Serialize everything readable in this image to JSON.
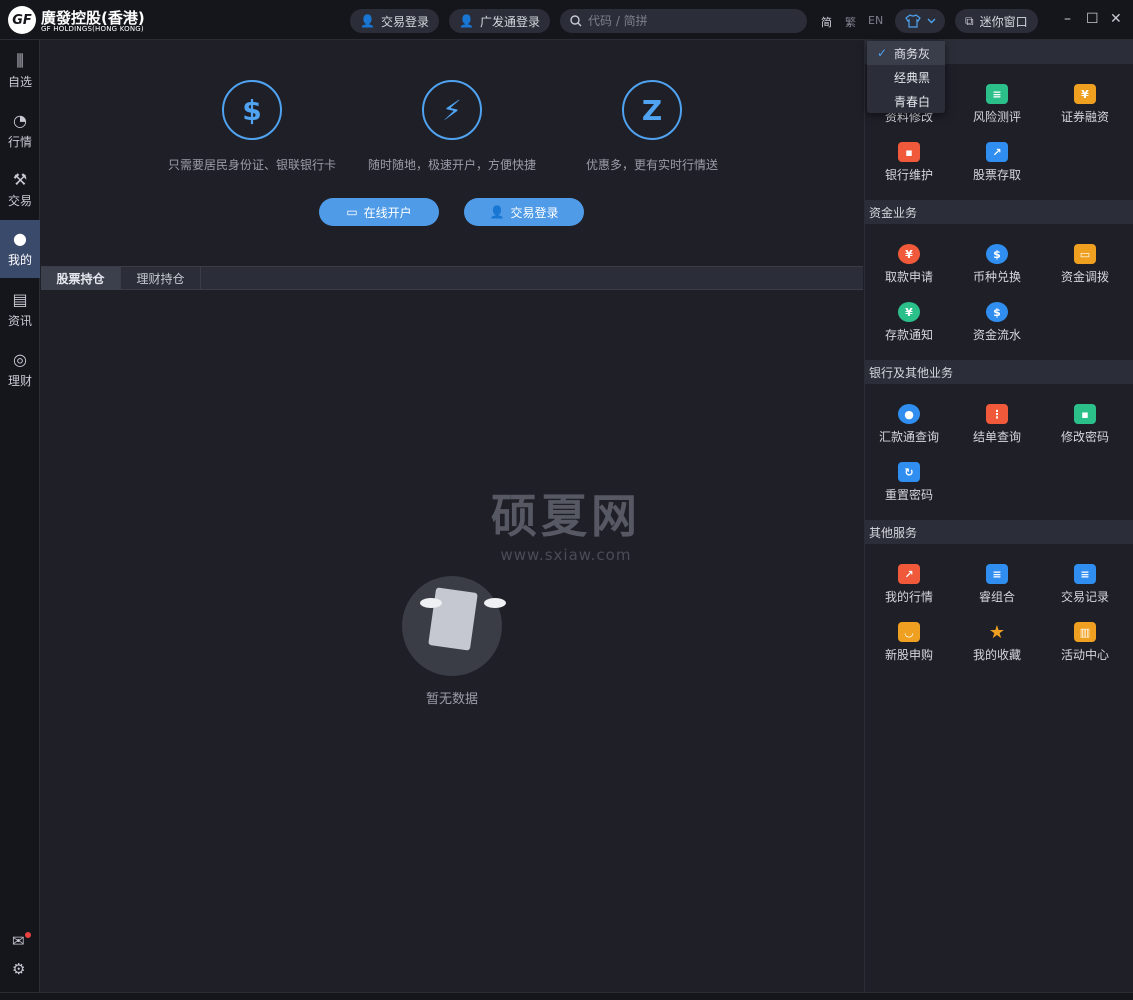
{
  "logo": {
    "mark": "GF",
    "name_cn": "廣發控股(香港)",
    "name_en": "GF HOLDINGS(HONG KONG)"
  },
  "header": {
    "trade_login": "交易登录",
    "gf_login": "广发通登录",
    "search_placeholder": "代码 / 简拼",
    "lang_simplified": "简",
    "lang_traditional": "繁",
    "lang_en": "EN",
    "mini_window": "迷你窗口"
  },
  "nav": {
    "items": [
      {
        "label": "自选",
        "icon": "candlestick-icon"
      },
      {
        "label": "行情",
        "icon": "trend-icon"
      },
      {
        "label": "交易",
        "icon": "gavel-icon"
      },
      {
        "label": "我的",
        "icon": "user-icon"
      },
      {
        "label": "资讯",
        "icon": "news-icon"
      },
      {
        "label": "理财",
        "icon": "coin-icon"
      }
    ],
    "active": "我的"
  },
  "features": [
    {
      "icon": "$",
      "text": "只需要居民身份证、银联银行卡"
    },
    {
      "icon": "⚡",
      "text": "随时随地，极速开户，方便快捷"
    },
    {
      "icon": "Z",
      "text": "优惠多，更有实时行情送"
    }
  ],
  "cta": {
    "open_account": "在线开户",
    "trade_login": "交易登录"
  },
  "tabs": [
    "股票持仓",
    "理财持仓"
  ],
  "watermark": {
    "title": "硕夏网",
    "url": "www.sxiaw.com"
  },
  "empty_state": {
    "text": "暂无数据"
  },
  "skin_menu": {
    "items": [
      "商务灰",
      "经典黑",
      "青春白"
    ],
    "selected": "商务灰"
  },
  "right_panel": {
    "sec0": {
      "items": [
        {
          "label": "资料修改",
          "color": "#2a9d6a"
        },
        {
          "label": "风险测评",
          "color": "#2bbf8a"
        },
        {
          "label": "证券融资",
          "color": "#f0a020"
        },
        {
          "label": "银行维护",
          "color": "#f05a3a"
        },
        {
          "label": "股票存取",
          "color": "#2f8ef0"
        }
      ]
    },
    "sec1": {
      "title": "资金业务",
      "items": [
        {
          "label": "取款申请",
          "color": "#f05a3a"
        },
        {
          "label": "币种兑换",
          "color": "#2f8ef0"
        },
        {
          "label": "资金调拨",
          "color": "#f0a020"
        },
        {
          "label": "存款通知",
          "color": "#2bbf8a"
        },
        {
          "label": "资金流水",
          "color": "#2f8ef0"
        }
      ]
    },
    "sec2": {
      "title": "银行及其他业务",
      "items": [
        {
          "label": "汇款通查询",
          "color": "#2f8ef0"
        },
        {
          "label": "结单查询",
          "color": "#f05a3a"
        },
        {
          "label": "修改密码",
          "color": "#2bbf8a"
        },
        {
          "label": "重置密码",
          "color": "#2f8ef0"
        }
      ]
    },
    "sec3": {
      "title": "其他服务",
      "items": [
        {
          "label": "我的行情",
          "color": "#f05a3a"
        },
        {
          "label": "睿组合",
          "color": "#2f8ef0"
        },
        {
          "label": "交易记录",
          "color": "#2f8ef0"
        },
        {
          "label": "新股申购",
          "color": "#f0a020"
        },
        {
          "label": "我的收藏",
          "color": "#f0a020"
        },
        {
          "label": "活动中心",
          "color": "#f0a020"
        }
      ]
    }
  },
  "colors": {
    "accent": "#4fa3f0",
    "bg": "#1e1f27",
    "panel": "#2b2d38"
  }
}
